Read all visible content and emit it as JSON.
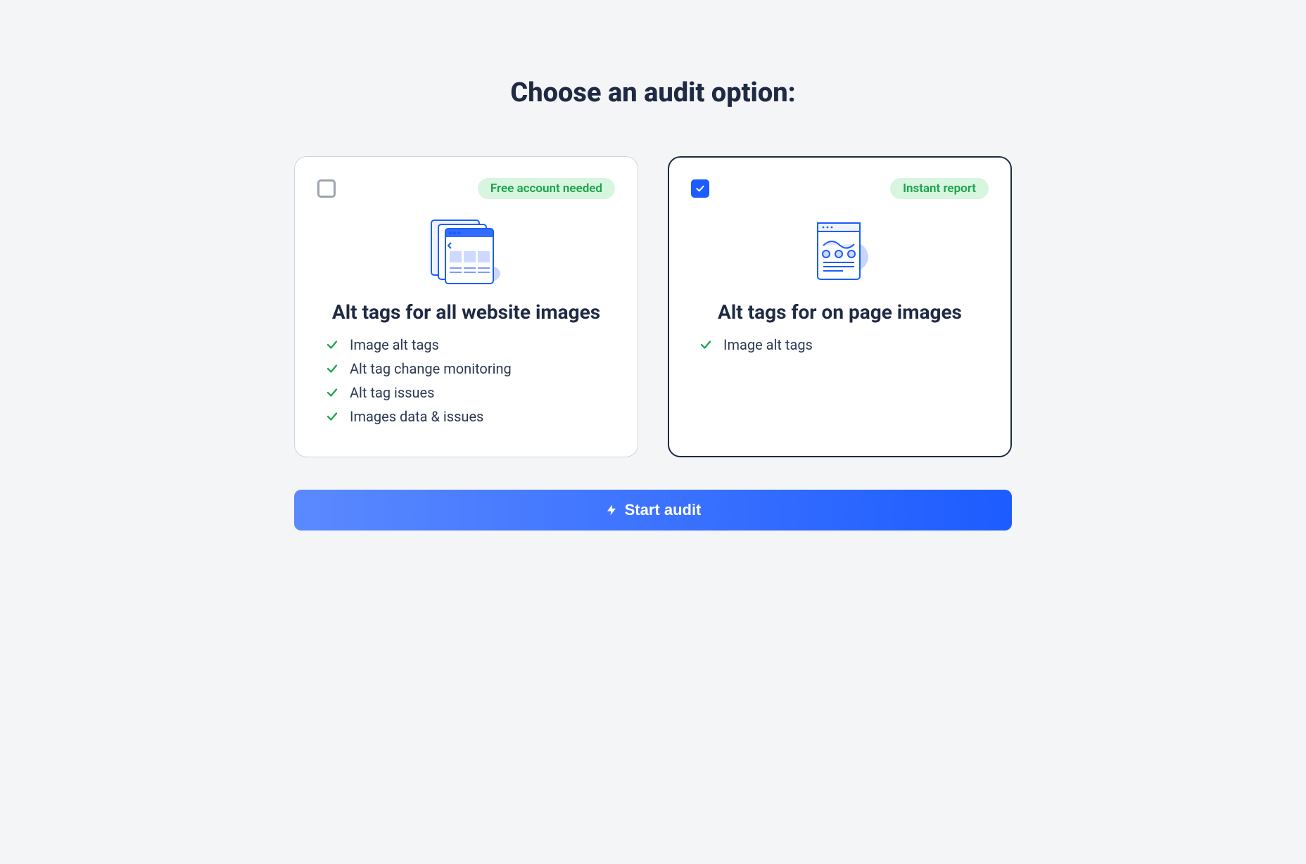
{
  "title": "Choose an audit option:",
  "cards": [
    {
      "badge": "Free account needed",
      "heading": "Alt tags for all website images",
      "features": [
        "Image alt tags",
        "Alt tag change monitoring",
        "Alt tag issues",
        "Images data & issues"
      ],
      "selected": false
    },
    {
      "badge": "Instant report",
      "heading": "Alt tags for on page images",
      "features": [
        "Image alt tags"
      ],
      "selected": true
    }
  ],
  "cta_label": "Start audit"
}
